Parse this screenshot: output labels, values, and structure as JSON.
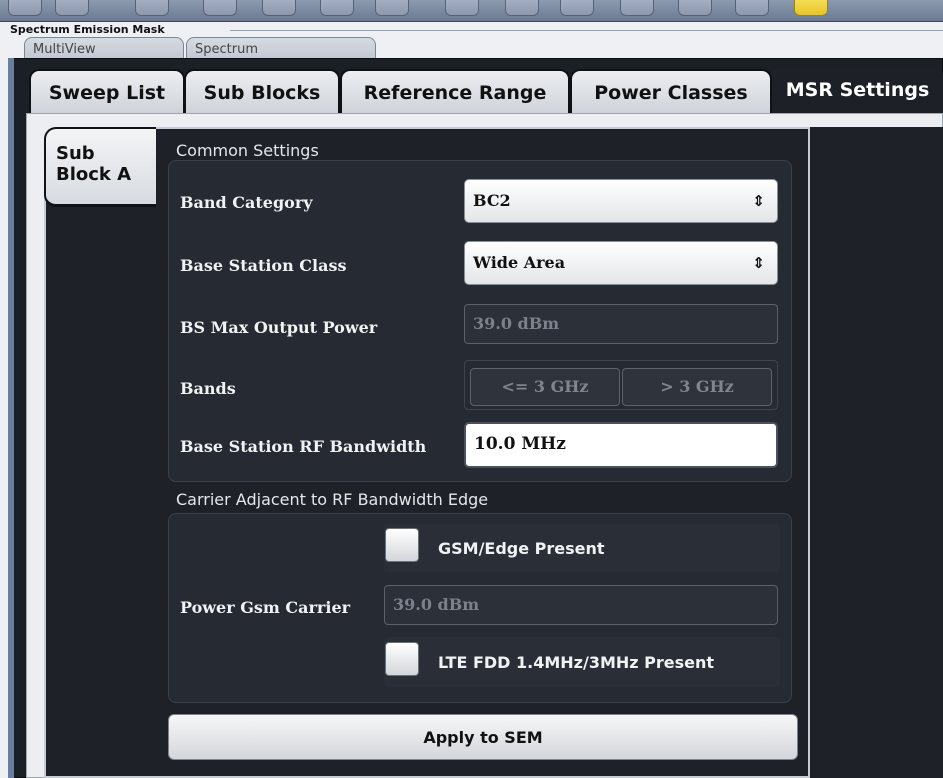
{
  "window": {
    "title": "Spectrum Emission Mask",
    "background_tabs": [
      "MultiView",
      "Spectrum"
    ]
  },
  "tabs": [
    {
      "label": "Sweep List",
      "active": false
    },
    {
      "label": "Sub Blocks",
      "active": false
    },
    {
      "label": "Reference Range",
      "active": false
    },
    {
      "label": "Power Classes",
      "active": false
    },
    {
      "label": "MSR Settings",
      "active": true
    }
  ],
  "subblock_tab": {
    "line1": "Sub",
    "line2": "Block A"
  },
  "common_settings": {
    "title": "Common Settings",
    "band_category": {
      "label": "Band Category",
      "value": "BC2"
    },
    "base_station_class": {
      "label": "Base Station Class",
      "value": "Wide Area"
    },
    "bs_max_output_power": {
      "label": "BS Max Output Power",
      "value": "39.0 dBm"
    },
    "bands": {
      "label": "Bands",
      "options": [
        "<= 3 GHz",
        "> 3 GHz"
      ]
    },
    "rf_bandwidth": {
      "label": "Base Station RF Bandwidth",
      "value": "10.0 MHz"
    }
  },
  "carrier_adjacent": {
    "title": "Carrier Adjacent to RF Bandwidth Edge",
    "gsm_edge": {
      "label": "GSM/Edge Present",
      "checked": false
    },
    "power_gsm_carrier": {
      "label": "Power Gsm Carrier",
      "value": "39.0 dBm"
    },
    "lte_fdd": {
      "label": "LTE FDD 1.4MHz/3MHz Present",
      "checked": false
    }
  },
  "apply_button": "Apply to SEM",
  "icons": [
    "toolbar-icons"
  ]
}
